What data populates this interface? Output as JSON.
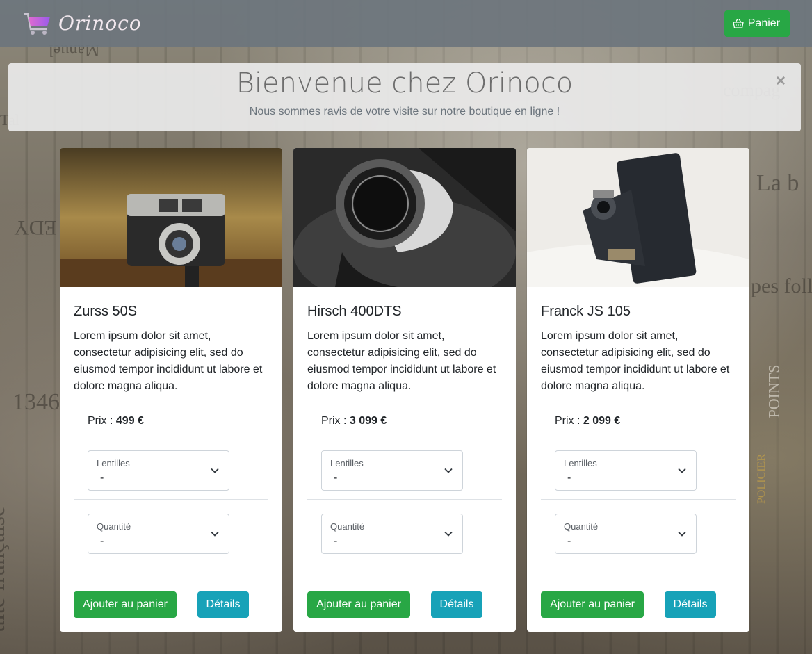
{
  "navbar": {
    "brand": "Orinoco",
    "cart_label": "Panier"
  },
  "alert": {
    "title": "Bienvenue chez Orinoco",
    "subtitle": "Nous sommes ravis de votre visite sur notre boutique en ligne !",
    "close": "×"
  },
  "products": [
    {
      "name": "Zurss 50S",
      "description": "Lorem ipsum dolor sit amet, consectetur adipisicing elit, sed do eiusmod tempor incididunt ut labore et dolore magna aliqua.",
      "price_label": "Prix : ",
      "price": "499 €",
      "lens_label": "Lentilles",
      "lens_value": "-",
      "qty_label": "Quantité",
      "qty_value": "-",
      "add_label": "Ajouter au panier",
      "details_label": "Détails"
    },
    {
      "name": "Hirsch 400DTS",
      "description": "Lorem ipsum dolor sit amet, consectetur adipisicing elit, sed do eiusmod tempor incididunt ut labore et dolore magna aliqua.",
      "price_label": "Prix : ",
      "price": "3 099 €",
      "lens_label": "Lentilles",
      "lens_value": "-",
      "qty_label": "Quantité",
      "qty_value": "-",
      "add_label": "Ajouter au panier",
      "details_label": "Détails"
    },
    {
      "name": "Franck JS 105",
      "description": "Lorem ipsum dolor sit amet, consectetur adipisicing elit, sed do eiusmod tempor incididunt ut labore et dolore magna aliqua.",
      "price_label": "Prix : ",
      "price": "2 099 €",
      "lens_label": "Lentilles",
      "lens_value": "-",
      "qty_label": "Quantité",
      "qty_value": "-",
      "add_label": "Ajouter au panier",
      "details_label": "Détails"
    }
  ],
  "background_text": [
    "Manuel",
    "EDY",
    "1346",
    "uite française",
    "La b",
    "pes foll",
    "POINTS",
    "POLICIER",
    "Tal",
    "compag"
  ],
  "colors": {
    "navbar": "#6c757d",
    "success": "#28a745",
    "info": "#17a2b8",
    "brand_text": "#f2e8ee",
    "alert_bg": "#e9e9e9"
  },
  "icons": {
    "logo": "shopping-cart-logo-icon",
    "cart": "basket-icon",
    "select": "chevron-down-icon"
  }
}
